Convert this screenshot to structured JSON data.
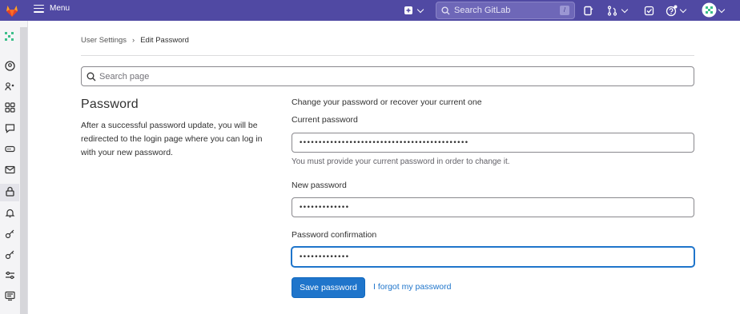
{
  "topbar": {
    "menu_label": "Menu",
    "search_placeholder": "Search GitLab",
    "search_shortcut": "/"
  },
  "breadcrumb": {
    "parent": "User Settings",
    "separator": "›",
    "current": "Edit Password"
  },
  "search_page": {
    "placeholder": "Search page"
  },
  "section": {
    "title": "Password",
    "description": "After a successful password update, you will be redirected to the login page where you can log in with your new password."
  },
  "form": {
    "lead": "Change your password or recover your current one",
    "current_label": "Current password",
    "current_value": "••••••••••••••••••••••••••••••••••••••••••••",
    "current_help": "You must provide your current password in order to change it.",
    "new_label": "New password",
    "new_value": "•••••••••••••",
    "confirm_label": "Password confirmation",
    "confirm_value": "•••••••••••••",
    "save_label": "Save password",
    "forgot_label": "I forgot my password"
  },
  "colors": {
    "topbar": "#5049a3",
    "primary": "#1f75cb"
  }
}
